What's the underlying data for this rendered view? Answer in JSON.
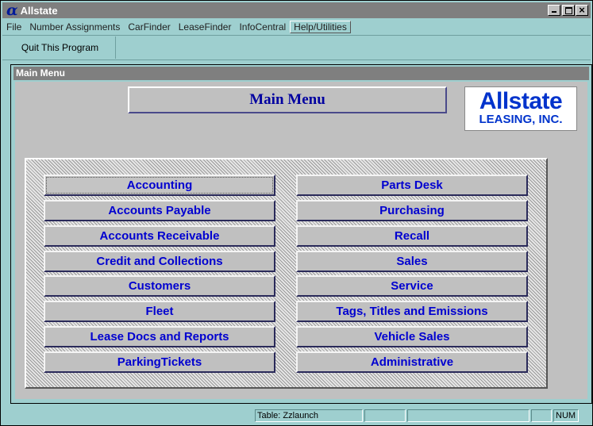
{
  "window": {
    "title": "Allstate",
    "app_icon_glyph": "α"
  },
  "menubar": [
    {
      "label": "File"
    },
    {
      "label": "Number Assignments"
    },
    {
      "label": "CarFinder"
    },
    {
      "label": "LeaseFinder"
    },
    {
      "label": "InfoCentral"
    },
    {
      "label": "Help/Utilities"
    }
  ],
  "toolbar": {
    "quit_label": "Quit This Program"
  },
  "form": {
    "title": "Main Menu",
    "heading": "Main Menu",
    "logo_line1": "Allstate",
    "logo_line2": "LEASING, INC."
  },
  "buttons_left": [
    "Accounting",
    "Accounts Payable",
    "Accounts Receivable",
    "Credit and Collections",
    "Customers",
    "Fleet",
    "Lease Docs and Reports",
    "ParkingTickets"
  ],
  "buttons_right": [
    "Parts Desk",
    "Purchasing",
    "Recall",
    "Sales",
    "Service",
    "Tags, Titles and Emissions",
    "Vehicle Sales",
    "Administrative"
  ],
  "statusbar": {
    "table": "Table: Zzlaunch",
    "num": "NUM"
  },
  "colors": {
    "background": "#9ecfcf",
    "titlebar": "#7f7f7f",
    "button_text": "#0000d0"
  }
}
